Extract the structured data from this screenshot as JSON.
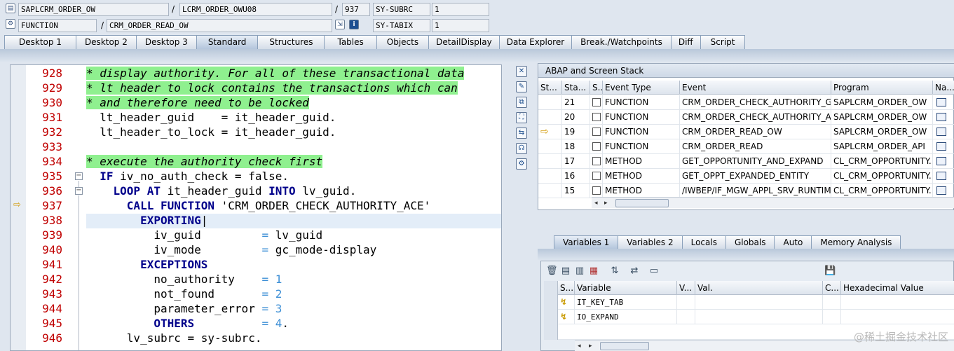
{
  "header": {
    "program": "SAPLCRM_ORDER_OW",
    "include": "LCRM_ORDER_OWU08",
    "line": "937",
    "subrc_label": "SY-SUBRC",
    "subrc_value": "1",
    "type": "FUNCTION",
    "function": "CRM_ORDER_READ_OW",
    "tabix_label": "SY-TABIX",
    "tabix_value": "1"
  },
  "tabs": [
    "Desktop 1",
    "Desktop 2",
    "Desktop 3",
    "Standard",
    "Structures",
    "Tables",
    "Objects",
    "DetailDisplay",
    "Data Explorer",
    "Break./Watchpoints",
    "Diff",
    "Script"
  ],
  "active_tab": "Standard",
  "editor": {
    "current_line": "937",
    "line_numbers": [
      "928",
      "929",
      "930",
      "931",
      "932",
      "933",
      "934",
      "935",
      "936",
      "937",
      "938",
      "939",
      "940",
      "941",
      "942",
      "943",
      "944",
      "945",
      "946"
    ]
  },
  "stack": {
    "title": "ABAP and Screen Stack",
    "columns": [
      "St...",
      "Sta...",
      "S...",
      "Event Type",
      "Event",
      "Program",
      "Na..."
    ],
    "rows": [
      {
        "level": "21",
        "type": "FUNCTION",
        "event": "CRM_ORDER_CHECK_AUTHORITY_GE...",
        "program": "SAPLCRM_ORDER_OW",
        "current": false
      },
      {
        "level": "20",
        "type": "FUNCTION",
        "event": "CRM_ORDER_CHECK_AUTHORITY_AC...",
        "program": "SAPLCRM_ORDER_OW",
        "current": false
      },
      {
        "level": "19",
        "type": "FUNCTION",
        "event": "CRM_ORDER_READ_OW",
        "program": "SAPLCRM_ORDER_OW",
        "current": true
      },
      {
        "level": "18",
        "type": "FUNCTION",
        "event": "CRM_ORDER_READ",
        "program": "SAPLCRM_ORDER_API",
        "current": false
      },
      {
        "level": "17",
        "type": "METHOD",
        "event": "GET_OPPORTUNITY_AND_EXPAND",
        "program": "CL_CRM_OPPORTUNITY...",
        "current": false
      },
      {
        "level": "16",
        "type": "METHOD",
        "event": "GET_OPPT_EXPANDED_ENTITY",
        "program": "CL_CRM_OPPORTUNITY...",
        "current": false
      },
      {
        "level": "15",
        "type": "METHOD",
        "event": "/IWBEP/IF_MGW_APPL_SRV_RUNTIM...",
        "program": "CL_CRM_OPPORTUNITY...",
        "current": false
      }
    ]
  },
  "var_tabs": [
    "Variables 1",
    "Variables 2",
    "Locals",
    "Globals",
    "Auto",
    "Memory Analysis"
  ],
  "active_var_tab": "Variables 1",
  "variables": {
    "columns": [
      "S...",
      "Variable",
      "V...",
      "Val.",
      "C...",
      "Hexadecimal Value"
    ],
    "rows": [
      {
        "name": "IT_KEY_TAB",
        "value": "",
        "hex": ""
      },
      {
        "name": "IO_EXPAND",
        "value": "",
        "hex": ""
      }
    ]
  },
  "watermark": "@稀土掘金技术社区"
}
